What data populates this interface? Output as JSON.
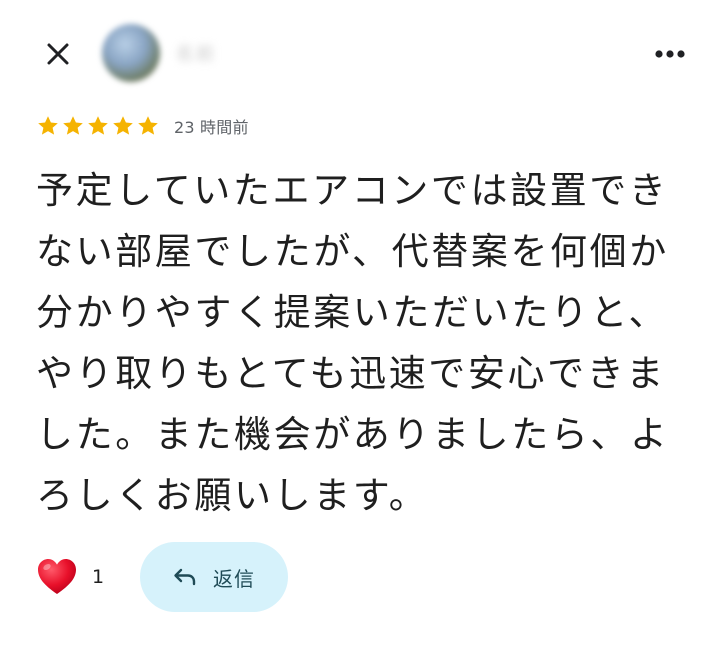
{
  "header": {
    "close_icon": "close-icon",
    "author_name": "名前",
    "more_icon": "more-vert-icon"
  },
  "rating": {
    "stars": 5,
    "max_stars": 5,
    "star_color": "#f5b301",
    "time": "23 時間前"
  },
  "review": {
    "text": "予定していたエアコンでは設置できない部屋でしたが、代替案を何個か分かりやすく提案いただいたりと、やり取りもとても迅速で安心できました。また機会がありましたら、よろしくお願いします。"
  },
  "reactions": {
    "icon": "heart-icon",
    "heart_color": "#e8102a",
    "count": "1"
  },
  "reply": {
    "icon": "reply-arrow-icon",
    "label": "返信",
    "background": "#d6f2fb"
  }
}
